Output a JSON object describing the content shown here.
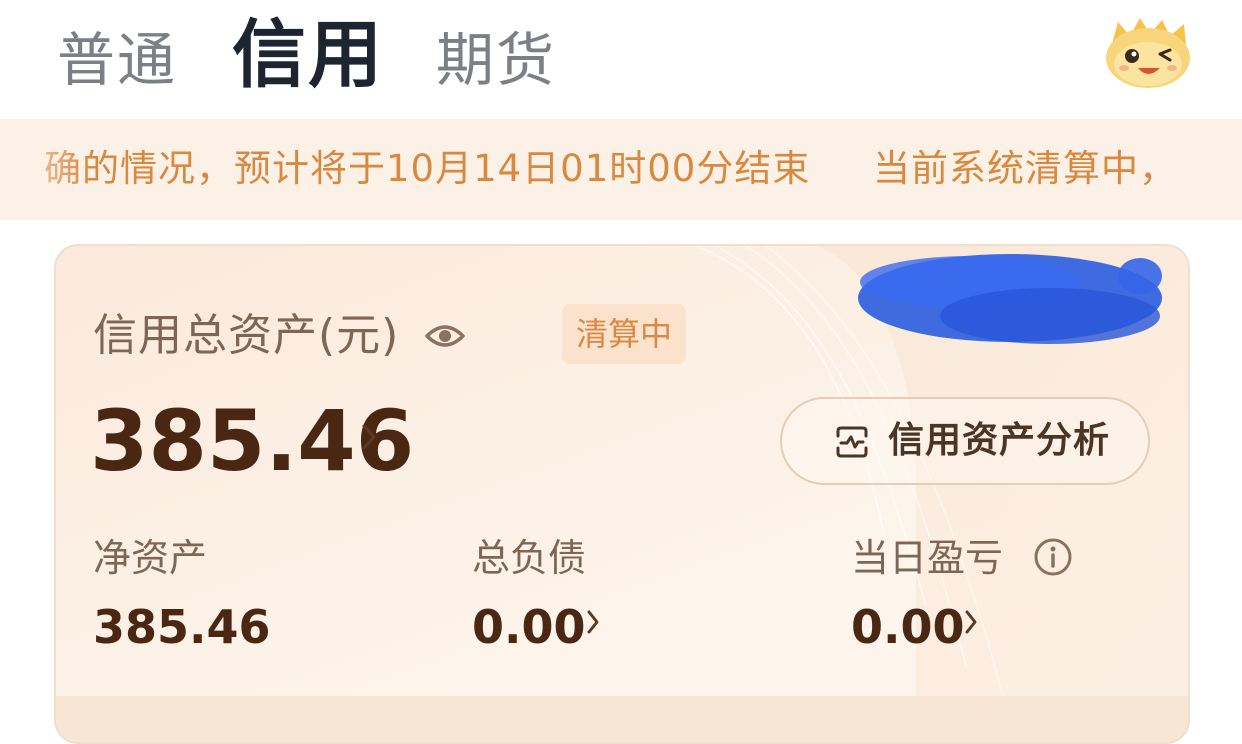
{
  "tabs": [
    {
      "label": "普通",
      "active": false
    },
    {
      "label": "信用",
      "active": true
    },
    {
      "label": "期货",
      "active": false
    }
  ],
  "mascot_icon": "dragon-mascot-icon",
  "notice": {
    "text_segment_1": "确的情况，预计将于10月14日01时00分结束",
    "text_segment_2": "当前系统清算中，"
  },
  "card": {
    "title": "信用总资产(元)",
    "eye_icon": "eye-icon",
    "status_badge": "清算中",
    "total_assets": "385.46",
    "analysis_button_label": "信用资产分析",
    "analysis_icon": "asset-analysis-icon",
    "metrics": [
      {
        "label": "净资产",
        "value": "385.46"
      },
      {
        "label": "总负债",
        "value": "0.00"
      },
      {
        "label": "当日盈亏",
        "value": "0.00"
      }
    ]
  },
  "colors": {
    "notice_text": "#d9883f",
    "badge_text": "#d88a45",
    "badge_bg": "#fbe2cc",
    "amount_text": "#4a2713",
    "redaction_blue": "#2f5fe0"
  }
}
